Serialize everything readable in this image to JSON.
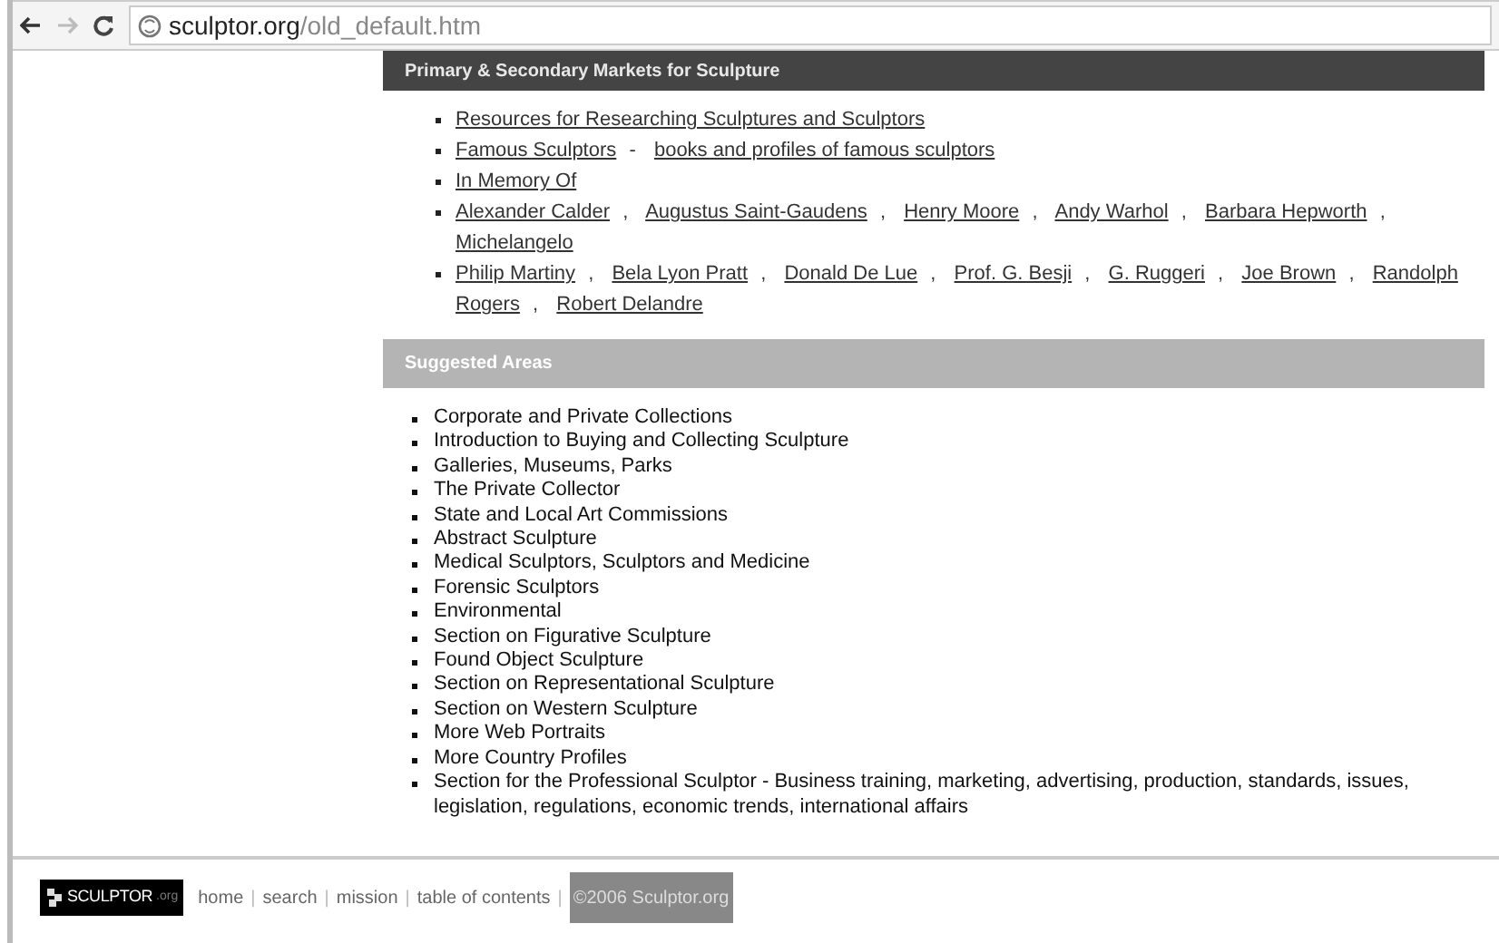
{
  "address_bar": {
    "host": "sculptor.org",
    "path": "/old_default.htm"
  },
  "markets": {
    "title": "Primary & Secondary Markets for Sculpture",
    "items": [
      [
        {
          "kind": "link",
          "text": "Resources for Researching Sculptures and Sculptors"
        }
      ],
      [
        {
          "kind": "link",
          "text": "Famous Sculptors"
        },
        {
          "kind": "sep",
          "text": "-"
        },
        {
          "kind": "link",
          "text": "books and profiles of famous sculptors"
        }
      ],
      [
        {
          "kind": "link",
          "text": "In Memory Of"
        }
      ],
      [
        {
          "kind": "link",
          "text": "Alexander Calder"
        },
        {
          "kind": "sep",
          "text": ","
        },
        {
          "kind": "link",
          "text": "Augustus Saint-Gaudens"
        },
        {
          "kind": "sep",
          "text": ","
        },
        {
          "kind": "link",
          "text": "Henry Moore"
        },
        {
          "kind": "sep",
          "text": ","
        },
        {
          "kind": "link",
          "text": "Andy Warhol"
        },
        {
          "kind": "sep",
          "text": ","
        },
        {
          "kind": "link",
          "text": "Barbara Hepworth"
        },
        {
          "kind": "sep",
          "text": ","
        },
        {
          "kind": "link",
          "text": "Michelangelo"
        }
      ],
      [
        {
          "kind": "link",
          "text": "Philip Martiny"
        },
        {
          "kind": "sep",
          "text": ","
        },
        {
          "kind": "link",
          "text": "Bela Lyon Pratt"
        },
        {
          "kind": "sep",
          "text": ","
        },
        {
          "kind": "link",
          "text": "Donald De Lue"
        },
        {
          "kind": "sep",
          "text": ","
        },
        {
          "kind": "link",
          "text": "Prof. G. Besji"
        },
        {
          "kind": "sep",
          "text": ","
        },
        {
          "kind": "link",
          "text": "G. Ruggeri"
        },
        {
          "kind": "sep",
          "text": ","
        },
        {
          "kind": "link",
          "text": "Joe Brown"
        },
        {
          "kind": "sep",
          "text": ","
        },
        {
          "kind": "link",
          "text": "Randolph"
        },
        {
          "kind": "link",
          "text": "Rogers"
        },
        {
          "kind": "sep",
          "text": ","
        },
        {
          "kind": "link",
          "text": "Robert Delandre"
        }
      ]
    ]
  },
  "suggested": {
    "title": "Suggested Areas",
    "items": [
      "Corporate and Private Collections",
      "Introduction to Buying and Collecting Sculpture",
      "Galleries, Museums, Parks",
      "The Private Collector",
      "State and Local Art Commissions",
      "Abstract Sculpture",
      "Medical Sculptors, Sculptors and Medicine",
      "Forensic Sculptors",
      "Environmental",
      "Section on Figurative Sculpture",
      "Found Object Sculpture",
      "Section on Representational Sculpture",
      "Section on Western Sculpture",
      "More Web Portraits",
      "More Country Profiles",
      "Section for the Professional Sculptor - Business training, marketing, advertising, production, standards, issues, legislation, regulations, economic trends, international affairs"
    ]
  },
  "footer": {
    "logo": {
      "name": "SCULPTOR",
      "suffix": ".org"
    },
    "links": [
      "home",
      "search",
      "mission",
      "table of contents"
    ],
    "separator": "|",
    "copyright": "©2006 Sculptor.org"
  }
}
